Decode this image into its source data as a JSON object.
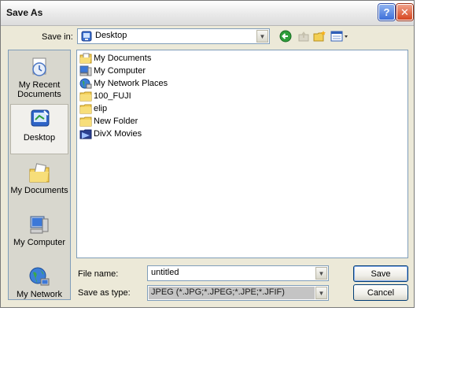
{
  "window": {
    "title": "Save As"
  },
  "toolbar": {
    "save_in_label": "Save in:",
    "save_in_value": "Desktop"
  },
  "places": [
    {
      "label": "My Recent Documents",
      "line1": "My Recent",
      "line2": "Documents"
    },
    {
      "label": "Desktop",
      "line1": "Desktop",
      "line2": ""
    },
    {
      "label": "My Documents",
      "line1": "My Documents",
      "line2": ""
    },
    {
      "label": "My Computer",
      "line1": "My Computer",
      "line2": ""
    },
    {
      "label": "My Network",
      "line1": "My Network",
      "line2": ""
    }
  ],
  "files": [
    {
      "name": "My Documents",
      "icon": "my-documents-icon"
    },
    {
      "name": "My Computer",
      "icon": "computer-icon"
    },
    {
      "name": "My Network Places",
      "icon": "network-icon"
    },
    {
      "name": "100_FUJI",
      "icon": "folder-icon"
    },
    {
      "name": "elip",
      "icon": "folder-icon"
    },
    {
      "name": "New Folder",
      "icon": "folder-icon"
    },
    {
      "name": "DivX Movies",
      "icon": "divx-folder-icon"
    }
  ],
  "form": {
    "file_name_label": "File name:",
    "file_name_value": "untitled",
    "save_type_label": "Save as type:",
    "save_type_value": "JPEG (*.JPG;*.JPEG;*.JPE;*.JFIF)"
  },
  "buttons": {
    "save": "Save",
    "cancel": "Cancel"
  }
}
